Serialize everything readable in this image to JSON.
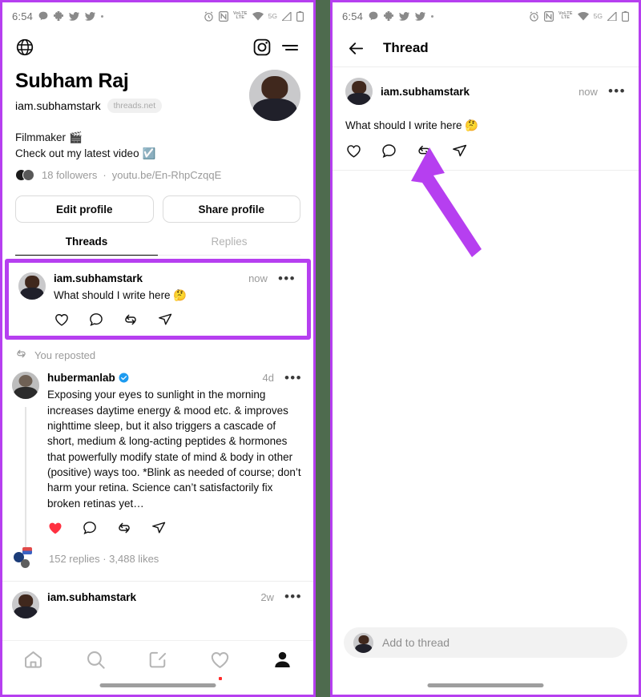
{
  "status_bar": {
    "time": "6:54",
    "left_icons": [
      "threads-icon",
      "app-plus-icon",
      "twitter-bird-icon",
      "twitter-bird-icon",
      "dot-icon"
    ],
    "right_icons": [
      "alarm-icon",
      "nfc-icon",
      "volte-icon",
      "wifi-icon",
      "5g-icon",
      "signal-icon",
      "battery-icon"
    ],
    "volte_top": "VoLTE",
    "volte_bottom": "LTE",
    "network": "5G"
  },
  "left_panel": {
    "header": {
      "globe_icon": "globe-icon",
      "instagram_icon": "instagram-icon",
      "menu_icon": "hamburger-menu-icon"
    },
    "profile": {
      "display_name": "Subham Raj",
      "handle": "iam.subhamstark",
      "domain_pill": "threads.net",
      "bio_line1": "Filmmaker",
      "bio_emoji1": "🎬",
      "bio_line2": "Check out my latest video",
      "bio_emoji2": "☑️",
      "followers": "18 followers",
      "separator": "·",
      "link": "youtu.be/En-RhpCzqqE",
      "edit_profile_label": "Edit profile",
      "share_profile_label": "Share profile"
    },
    "tabs": [
      {
        "label": "Threads",
        "active": true
      },
      {
        "label": "Replies",
        "active": false
      }
    ],
    "highlighted_post": {
      "user": "iam.subhamstark",
      "time": "now",
      "text": "What should I write here",
      "emoji": "🤔",
      "actions": [
        "like-icon",
        "comment-icon",
        "repost-icon",
        "share-icon"
      ]
    },
    "repost": {
      "repost_label": "You reposted",
      "user": "hubermanlab",
      "verified": true,
      "time": "4d",
      "text": "Exposing your eyes to sunlight in the morning increases daytime energy & mood etc. & improves nighttime sleep, but it also triggers a cascade of short, medium & long-acting peptides & hormones that powerfully modify state of mind & body in other (positive) ways too. *Blink as needed of course; don’t harm your retina. Science can’t satisfactorily fix broken retinas yet…",
      "liked": true,
      "meta": "152 replies · 3,488 likes"
    },
    "older_post": {
      "user": "iam.subhamstark",
      "time": "2w"
    },
    "bottom_nav": [
      {
        "name": "home-icon",
        "label": "Home",
        "active": false
      },
      {
        "name": "search-icon",
        "label": "Search",
        "active": false
      },
      {
        "name": "compose-icon",
        "label": "Compose",
        "active": false
      },
      {
        "name": "activity-icon",
        "label": "Activity",
        "active": false,
        "badge": true
      },
      {
        "name": "profile-icon",
        "label": "Profile",
        "active": true
      }
    ]
  },
  "right_panel": {
    "header": {
      "back_icon": "back-arrow-icon",
      "title": "Thread"
    },
    "post": {
      "user": "iam.subhamstark",
      "time": "now",
      "text": "What should I write here",
      "emoji": "🤔",
      "actions": [
        "like-icon",
        "comment-icon",
        "repost-icon",
        "share-icon"
      ]
    },
    "composer": {
      "placeholder": "Add to thread"
    }
  },
  "annotations": {
    "highlight_color": "#b63ff0",
    "arrow_color": "#b63ff0",
    "arrow_target": "share-icon",
    "divider_color": "#4e6b4e"
  }
}
